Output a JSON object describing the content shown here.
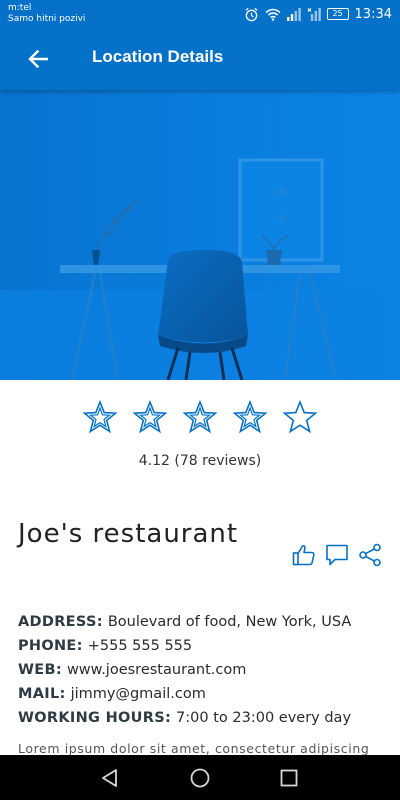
{
  "status_bar": {
    "carrier": "m:tel",
    "carrier_note": "Samo hitni pozivi",
    "battery": "25",
    "time": "13:34",
    "icons": [
      "alarm-icon",
      "wifi-icon",
      "signal-icon",
      "signal-no-sim-icon",
      "battery-icon"
    ]
  },
  "app_bar": {
    "title": "Location Details",
    "back_icon": "arrow-left-icon",
    "background_color": "#0571c9"
  },
  "hero": {
    "subject": "chair-and-desk-photo",
    "tint_color": "#0a78d8"
  },
  "rating": {
    "value": 4.12,
    "max": 5,
    "filled_stars": 0,
    "text": "4.12 (78 reviews)",
    "star_color": "#0571c9"
  },
  "place": {
    "name": "Joe's restaurant",
    "actions": [
      "thumbs-up-icon",
      "comment-icon",
      "share-icon"
    ]
  },
  "details": {
    "address_label": "ADDRESS:",
    "address": "Boulevard of food, New York, USA",
    "phone_label": "PHONE:",
    "phone": "+555 555 555",
    "web_label": "WEB:",
    "web": "www.joesrestaurant.com",
    "mail_label": "MAIL:",
    "mail": "jimmy@gmail.com",
    "hours_label": "WORKING HOURS:",
    "hours": "7:00 to 23:00 every day"
  },
  "description": "Lorem ipsum dolor sit amet, consectetur adipiscing",
  "nav_bar": {
    "icons": [
      "back-triangle-icon",
      "home-circle-icon",
      "recents-square-icon"
    ]
  }
}
